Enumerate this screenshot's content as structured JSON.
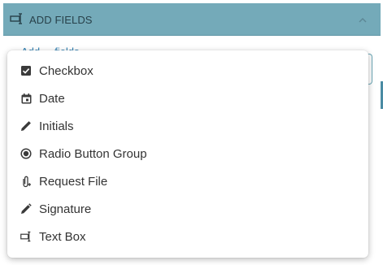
{
  "header": {
    "title": "ADD FIELDS",
    "icon": "text-box-icon",
    "chevron": "chevron-up-icon",
    "background": "#74aab9"
  },
  "behind": {
    "link_text": "Add ... fields"
  },
  "menu": {
    "items": [
      {
        "label": "Checkbox",
        "icon": "checkbox-icon"
      },
      {
        "label": "Date",
        "icon": "calendar-icon"
      },
      {
        "label": "Initials",
        "icon": "pen-icon"
      },
      {
        "label": "Radio Button Group",
        "icon": "radio-button-icon"
      },
      {
        "label": "Request File",
        "icon": "paperclip-icon"
      },
      {
        "label": "Signature",
        "icon": "signature-pen-icon"
      },
      {
        "label": "Text Box",
        "icon": "text-box-icon"
      }
    ]
  }
}
